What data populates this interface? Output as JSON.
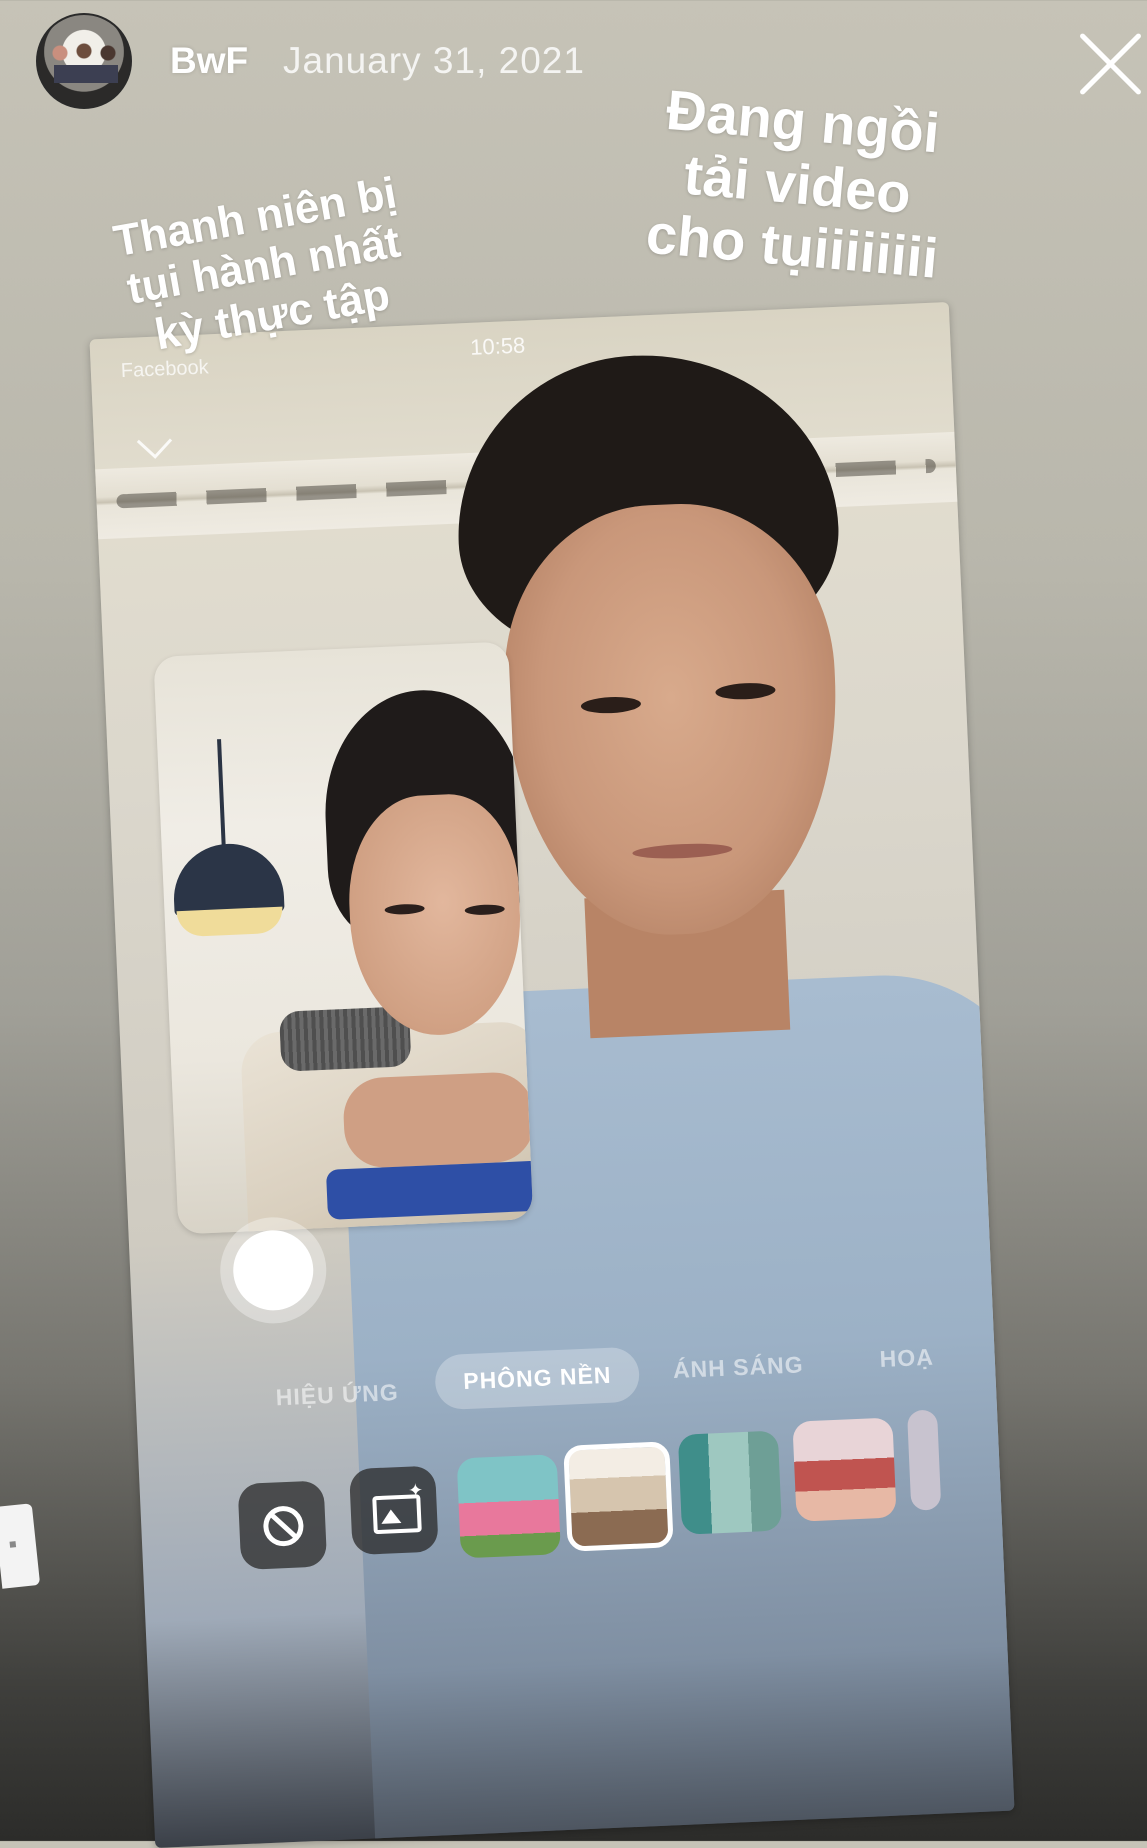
{
  "header": {
    "username": "BwF",
    "date": "January 31, 2021",
    "close_icon": "close-icon",
    "avatar_icon": "profile-avatar"
  },
  "captions": {
    "left_lines": [
      "Thanh niên bị",
      "tụi hành nhất",
      "kỳ thực tập"
    ],
    "right_lines": [
      "Đang ngồi",
      "tải video",
      "cho tụiiiiiiii"
    ]
  },
  "screenshot": {
    "status_time": "10:58",
    "back_app": "Facebook",
    "modes": [
      "HIỆU ỨNG",
      "PHÔNG NỀN",
      "ÁNH SÁNG",
      "HOẠ"
    ],
    "active_mode": "PHÔNG NỀN",
    "tools": [
      "no-effect-icon",
      "gallery-icon"
    ],
    "background_thumbnails": [
      "pink-house",
      "room",
      "teal-door",
      "ferris-wheel",
      "partial"
    ]
  },
  "colors": {
    "text": "#ffffff",
    "shirt": "#a8bcd0"
  }
}
